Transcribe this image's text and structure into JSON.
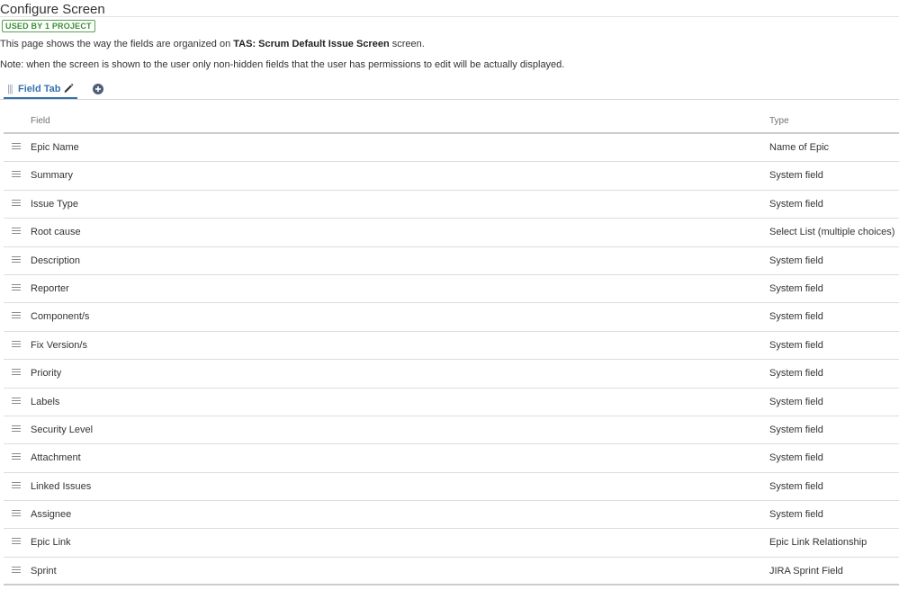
{
  "page": {
    "title": "Configure Screen",
    "badge": "USED BY 1 PROJECT",
    "description_prefix": "This page shows the way the fields are organized on ",
    "screen_name": "TAS: Scrum Default Issue Screen",
    "description_suffix": " screen.",
    "note": "Note: when the screen is shown to the user only non-hidden fields that the user has permissions to edit will be actually displayed."
  },
  "tabs": {
    "active_label": "Field Tab",
    "grip_glyph": "|||",
    "edit_icon": "pencil-icon",
    "add_icon": "plus-circle-icon"
  },
  "table": {
    "headers": {
      "field": "Field",
      "type": "Type"
    },
    "rows": [
      {
        "field": "Epic Name",
        "type": "Name of Epic"
      },
      {
        "field": "Summary",
        "type": "System field"
      },
      {
        "field": "Issue Type",
        "type": "System field"
      },
      {
        "field": "Root cause",
        "type": "Select List (multiple choices)"
      },
      {
        "field": "Description",
        "type": "System field"
      },
      {
        "field": "Reporter",
        "type": "System field"
      },
      {
        "field": "Component/s",
        "type": "System field"
      },
      {
        "field": "Fix Version/s",
        "type": "System field"
      },
      {
        "field": "Priority",
        "type": "System field"
      },
      {
        "field": "Labels",
        "type": "System field"
      },
      {
        "field": "Security Level",
        "type": "System field"
      },
      {
        "field": "Attachment",
        "type": "System field"
      },
      {
        "field": "Linked Issues",
        "type": "System field"
      },
      {
        "field": "Assignee",
        "type": "System field"
      },
      {
        "field": "Epic Link",
        "type": "Epic Link Relationship"
      },
      {
        "field": "Sprint",
        "type": "JIRA Sprint Field"
      }
    ]
  },
  "colors": {
    "accent": "#3572b0",
    "badge_green": "#3b8f34",
    "text": "#333333"
  }
}
